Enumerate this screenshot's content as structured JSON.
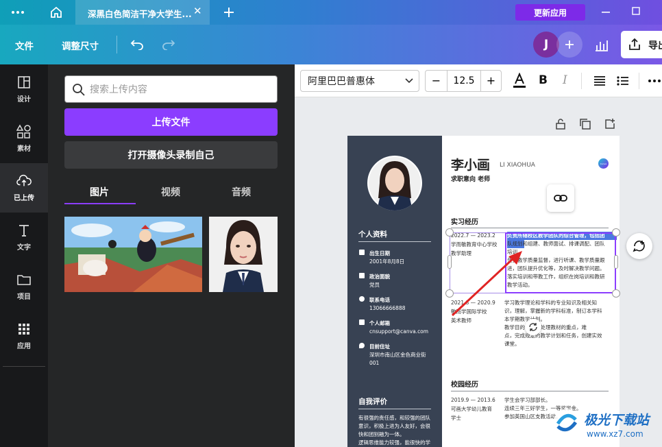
{
  "topbar": {
    "tab_title": "深黑白色简洁干净大学生...",
    "update_button": "更新应用"
  },
  "toolbar": {
    "file_menu": "文件",
    "resize_menu": "调整尺寸",
    "avatar_letter": "J",
    "export_label": "导出"
  },
  "rail": {
    "items": [
      {
        "label": "设计",
        "icon": "layout-icon"
      },
      {
        "label": "素材",
        "icon": "shapes-icon"
      },
      {
        "label": "已上传",
        "icon": "cloud-upload-icon"
      },
      {
        "label": "文字",
        "icon": "text-icon"
      },
      {
        "label": "项目",
        "icon": "folder-icon"
      },
      {
        "label": "应用",
        "icon": "grid-icon"
      }
    ]
  },
  "panel": {
    "search_placeholder": "搜索上传内容",
    "upload_button": "上传文件",
    "camera_button": "打开摄像头录制自己",
    "tabs": [
      "图片",
      "视频",
      "音频"
    ]
  },
  "format": {
    "font_name": "阿里巴巴普惠体",
    "font_size": "12.5",
    "minus": "−",
    "plus": "+",
    "bold": "B",
    "italic": "I"
  },
  "resume": {
    "name": "李小画",
    "name_pinyin": "LI XIAOHUA",
    "objective": "求职意向 老师",
    "badge": "Canva",
    "side": {
      "personal_title": "个人资料",
      "birth_label": "出生日期",
      "birth_value": "2001年8月8日",
      "politics_label": "政治面貌",
      "politics_value": "党员",
      "phone_label": "联系电话",
      "phone_value": "13066666888",
      "email_label": "个人邮箱",
      "email_value": "cnsupport@canva.com",
      "address_label": "目前住址",
      "address_line1": "深圳市南山区金色商业街",
      "address_line2": "001",
      "self_title": "自我评价",
      "self_lines": [
        "有很强的责任感，和较强的团队",
        "意识，积极上进为人友好，会很",
        "快和团别融为一体。",
        "逻辑思维能力较强，能很快的学"
      ]
    },
    "intern_title": "实习经历",
    "intern": [
      {
        "date": "2022.7 — 2023.2",
        "org": "学而敏教育中心学校",
        "role": "教学助理",
        "desc": [
          "负责所辖校区教学团队的综合管理，包括团",
          "队规划和组建、教师面试、排课调配、团队",
          "培训。",
          "负责教学质量监督，进行听课、教学质量跟",
          "进，团队提升优化等，及时解决教学问题。",
          "落实培训和带教工作，组织在岗培训和教研",
          "教学活动。"
        ]
      },
      {
        "date": "2021.8 — 2020.9",
        "org": "敏而学国际学校",
        "role": "英术教师",
        "desc": [
          "学习教学理论和学科的专业知识及相关知",
          "识，理解，掌握新的学科标准，制订本学科",
          "本学期教学计划。",
          "教学目的，恰当处理教材的重点，难",
          "点，完成规定的教学计划和任务，创建实效",
          "课堂。"
        ]
      }
    ],
    "campus_title": "校园经历",
    "campus": [
      {
        "date": "2019.9 — 2013.6",
        "org": "可画大学幼儿教育",
        "role": "学士",
        "desc": [
          "学生会学习部部长。",
          "连续三年三好学生，一等奖学金。",
          "参加英国山区支教活动。"
        ]
      }
    ]
  },
  "watermark": {
    "brand": "极光下载站",
    "url": "www.xz7.com"
  }
}
